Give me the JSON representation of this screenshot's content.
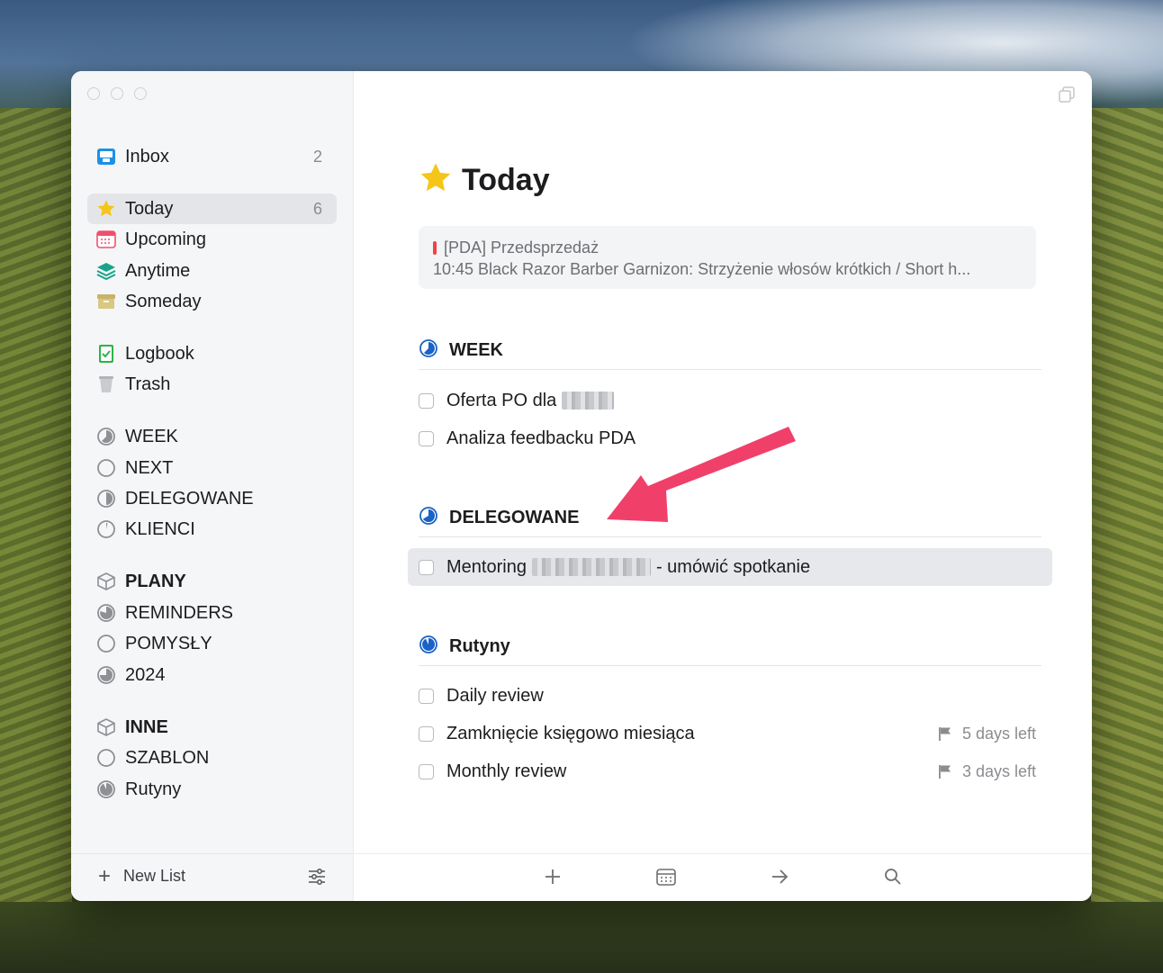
{
  "sidebar": {
    "inbox": {
      "label": "Inbox",
      "count": "2"
    },
    "today": {
      "label": "Today",
      "count": "6"
    },
    "upcoming": {
      "label": "Upcoming"
    },
    "anytime": {
      "label": "Anytime"
    },
    "someday": {
      "label": "Someday"
    },
    "logbook": {
      "label": "Logbook"
    },
    "trash": {
      "label": "Trash"
    },
    "projects_top": [
      "WEEK",
      "NEXT",
      "DELEGOWANE",
      "KLIENCI"
    ],
    "area_plany": "PLANY",
    "projects_plany": [
      "REMINDERS",
      "POMYSŁY",
      "2024"
    ],
    "area_inne": "INNE",
    "projects_inne": [
      "SZABLON",
      "Rutyny"
    ],
    "new_list": "New List"
  },
  "main": {
    "title": "Today",
    "event": {
      "calendar": "[PDA] Przedsprzedaż",
      "detail": "10:45 Black Razor Barber Garnizon: Strzyżenie włosów krótkich / Short h..."
    },
    "sections": [
      {
        "name": "WEEK",
        "tasks": [
          "Oferta PO dla",
          "Analiza feedbacku PDA"
        ]
      },
      {
        "name": "DELEGOWANE",
        "tasks": [
          "Mentoring",
          "- umówić spotkanie"
        ]
      },
      {
        "name": "Rutyny",
        "tasks": [
          "Daily review",
          "Zamknięcie księgowo miesiąca",
          "Monthly review"
        ]
      }
    ],
    "deadlines": [
      "5 days left",
      "3 days left"
    ]
  },
  "colors": {
    "accent": "#1a62c6",
    "today_star": "#f5c518",
    "arrow": "#f0406a"
  }
}
